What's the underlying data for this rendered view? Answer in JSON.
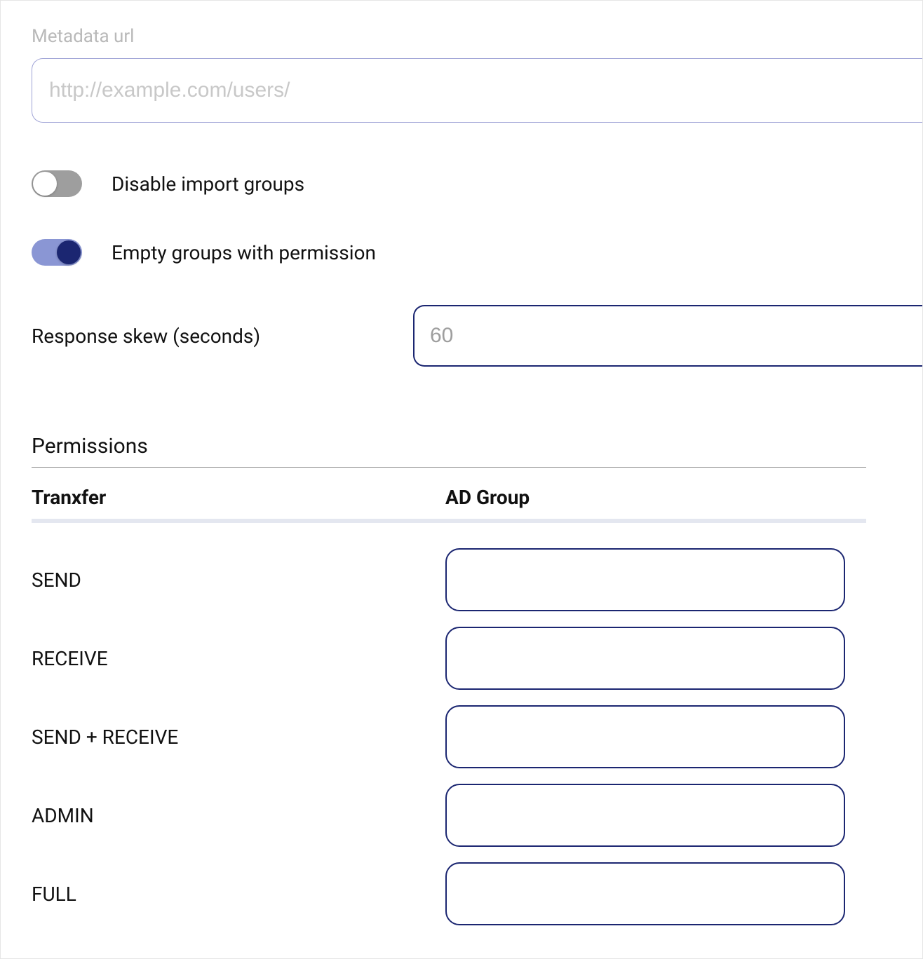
{
  "metadata": {
    "label": "Metadata url",
    "placeholder": "http://example.com/users/",
    "value": ""
  },
  "toggles": {
    "disable_import_groups": {
      "label": "Disable import groups",
      "on": false
    },
    "empty_groups_with_permission": {
      "label": "Empty groups with permission",
      "on": true
    }
  },
  "response_skew": {
    "label": "Response skew (seconds)",
    "placeholder": "60",
    "value": ""
  },
  "permissions": {
    "heading": "Permissions",
    "columns": {
      "tranxfer": "Tranxfer",
      "ad_group": "AD Group"
    },
    "rows": [
      {
        "label": "SEND",
        "value": ""
      },
      {
        "label": "RECEIVE",
        "value": ""
      },
      {
        "label": "SEND + RECEIVE",
        "value": ""
      },
      {
        "label": "ADMIN",
        "value": ""
      },
      {
        "label": "FULL",
        "value": ""
      }
    ]
  }
}
